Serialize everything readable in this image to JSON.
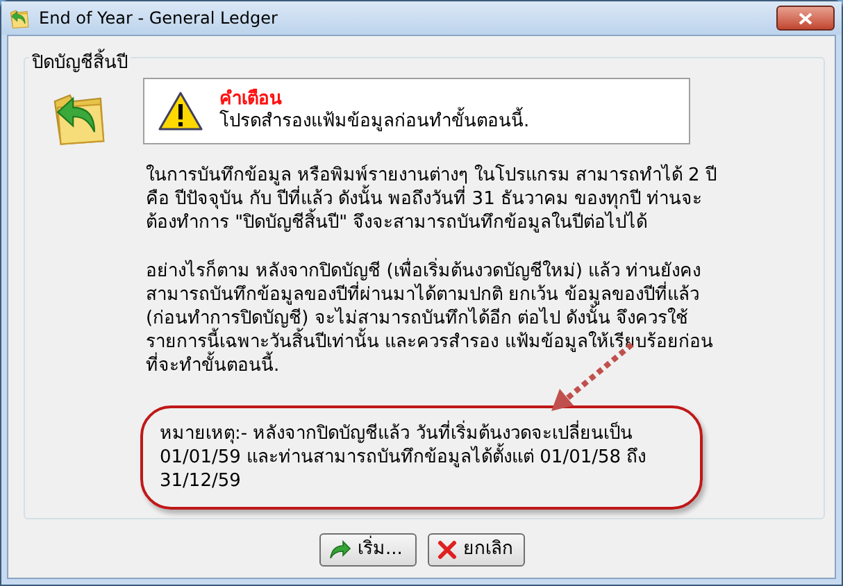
{
  "window": {
    "title": "End of Year - General Ledger"
  },
  "group": {
    "title": "ปิดบัญชีสิ้นปี"
  },
  "warning": {
    "title": "คำเตือน",
    "message": "โปรดสำรองแฟ้มข้อมูลก่อนทำขั้นตอนนี้."
  },
  "paragraphs": [
    "ในการบันทึกข้อมูล หรือพิมพ์รายงานต่างๆ ในโปรแกรม สามารถทำได้ 2 ปี คือ ปีปัจจุบัน กับ ปีที่แล้ว ดังนั้น พอถึงวันที่ 31 ธันวาคม ของทุกปี ท่านจะต้องทำการ \"ปิดบัญชีสิ้นปี\" จึงจะสามารถบันทึกข้อมูลในปีต่อไปได้",
    "อย่างไรก็ตาม หลังจากปิดบัญชี (เพื่อเริ่มต้นงวดบัญชีใหม่) แล้ว ท่านยังคงสามารถบันทึกข้อมูลของปีที่ผ่านมาได้ตามปกติ ยกเว้น ข้อมูลของปีที่แล้ว (ก่อนทำการปิดบัญชี) จะไม่สามารถบันทึกได้อีก ต่อไป ดังนั้น จึงควรใช้รายการนี้เฉพาะวันสิ้นปีเท่านั้น และควรสำรอง แฟ้มข้อมูลให้เรียบร้อยก่อนที่จะทำขั้นตอนนี้."
  ],
  "note": "หมายเหตุ:- หลังจากปิดบัญชีแล้ว วันที่เริ่มต้นงวดจะเปลี่ยนเป็น 01/01/59 และท่านสามารถบันทึกข้อมูลได้ตั้งแต่ 01/01/58 ถึง 31/12/59",
  "buttons": [
    {
      "kind": "start",
      "label": "เริ่ม..."
    },
    {
      "kind": "cancel",
      "label": "ยกเลิก"
    }
  ]
}
